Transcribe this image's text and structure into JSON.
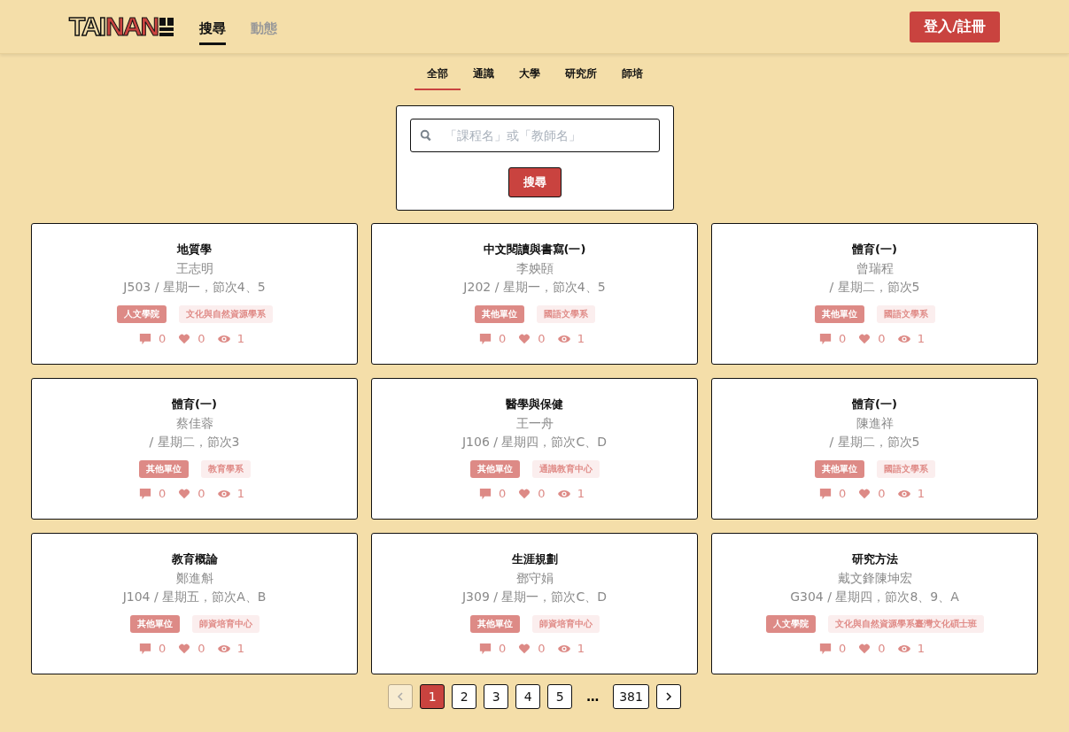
{
  "header": {
    "logo": {
      "part_1": "TAI",
      "part_2": "NAN"
    },
    "nav": [
      {
        "label": "搜尋",
        "selected": true
      },
      {
        "label": "動態",
        "selected": false
      }
    ],
    "login_button": "登入/註冊"
  },
  "categories": [
    {
      "label": "全部",
      "selected": true
    },
    {
      "label": "通識",
      "selected": false
    },
    {
      "label": "大學",
      "selected": false
    },
    {
      "label": "研究所",
      "selected": false
    },
    {
      "label": "師培",
      "selected": false
    }
  ],
  "search": {
    "placeholder": "「課程名」或「教師名」",
    "button": "搜尋"
  },
  "courses": [
    {
      "title": "地質學",
      "teacher": "王志明",
      "schedule": "J503 / 星期一，節次4、5",
      "college": "人文學院",
      "department": "文化與自然資源學系",
      "comments": "0",
      "likes": "0",
      "views": "1"
    },
    {
      "title": "中文閱讀與書寫(一)",
      "teacher": "李姎頣",
      "schedule": "J202 / 星期一，節次4、5",
      "college": "其他單位",
      "department": "國語文學系",
      "comments": "0",
      "likes": "0",
      "views": "1"
    },
    {
      "title": "體育(一)",
      "teacher": "曾瑞程",
      "schedule": "/ 星期二，節次5",
      "college": "其他單位",
      "department": "國語文學系",
      "comments": "0",
      "likes": "0",
      "views": "1"
    },
    {
      "title": "體育(一)",
      "teacher": "蔡佳蓉",
      "schedule": "/ 星期二，節次3",
      "college": "其他單位",
      "department": "教育學系",
      "comments": "0",
      "likes": "0",
      "views": "1"
    },
    {
      "title": "醫學與保健",
      "teacher": "王一舟",
      "schedule": "J106 / 星期四，節次C、D",
      "college": "其他單位",
      "department": "通識教育中心",
      "comments": "0",
      "likes": "0",
      "views": "1"
    },
    {
      "title": "體育(一)",
      "teacher": "陳進祥",
      "schedule": "/ 星期二，節次5",
      "college": "其他單位",
      "department": "國語文學系",
      "comments": "0",
      "likes": "0",
      "views": "1"
    },
    {
      "title": "教育概論",
      "teacher": "鄭進斛",
      "schedule": "J104 / 星期五，節次A、B",
      "college": "其他單位",
      "department": "師資培育中心",
      "comments": "0",
      "likes": "0",
      "views": "1"
    },
    {
      "title": "生涯規劃",
      "teacher": "鄧守娟",
      "schedule": "J309 / 星期一，節次C、D",
      "college": "其他單位",
      "department": "師資培育中心",
      "comments": "0",
      "likes": "0",
      "views": "1"
    },
    {
      "title": "研究方法",
      "teacher": "戴文鋒陳坤宏",
      "schedule": "G304 / 星期四，節次8、9、A",
      "college": "人文學院",
      "department": "文化與自然資源學系臺灣文化碩士班",
      "comments": "0",
      "likes": "0",
      "views": "1"
    }
  ],
  "pagination": {
    "prev_disabled": true,
    "pages": [
      {
        "label": "1",
        "selected": true
      },
      {
        "label": "2",
        "selected": false
      },
      {
        "label": "3",
        "selected": false
      },
      {
        "label": "4",
        "selected": false
      },
      {
        "label": "5",
        "selected": false
      },
      {
        "label": "…",
        "kind": "ellipsis"
      },
      {
        "label": "381",
        "selected": false
      }
    ]
  }
}
